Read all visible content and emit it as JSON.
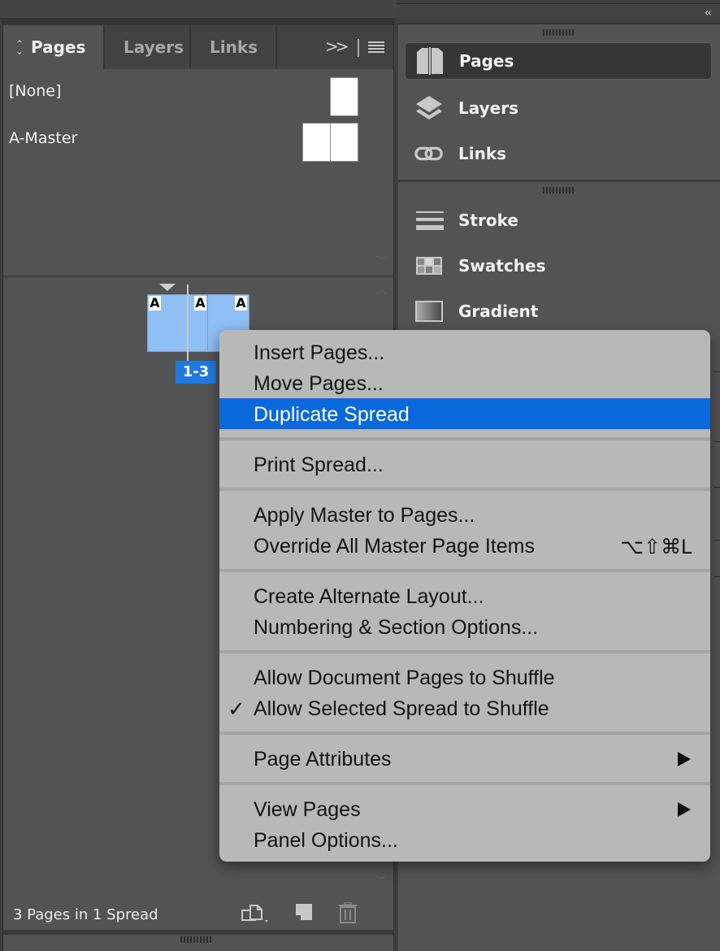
{
  "left_panel": {
    "tabs": [
      {
        "label": "Pages",
        "active": true
      },
      {
        "label": "Layers",
        "active": false
      },
      {
        "label": "Links",
        "active": false
      }
    ],
    "tab_overflow": "»",
    "masters": [
      {
        "name": "[None]",
        "pages": 1
      },
      {
        "name": "A-Master",
        "pages": 2
      }
    ],
    "spread": {
      "page_label": "1-3",
      "page_count": 3,
      "master_prefix": "A"
    },
    "footer": {
      "status": "3 Pages in 1 Spread",
      "icons": [
        "edit-page-size-icon",
        "new-page-icon",
        "delete-page-icon"
      ]
    }
  },
  "right_dock": {
    "collapse_label": "‹‹",
    "groups": [
      {
        "items": [
          {
            "label": "Pages",
            "icon": "pages-icon",
            "active": true
          },
          {
            "label": "Layers",
            "icon": "layers-icon",
            "active": false
          },
          {
            "label": "Links",
            "icon": "links-icon",
            "active": false
          }
        ]
      },
      {
        "items": [
          {
            "label": "Stroke",
            "icon": "stroke-icon",
            "active": false
          },
          {
            "label": "Swatches",
            "icon": "swatches-icon",
            "active": false
          },
          {
            "label": "Gradient",
            "icon": "gradient-icon",
            "active": false
          }
        ]
      }
    ]
  },
  "context_menu": {
    "highlight_color": "#0a68dd",
    "groups": [
      [
        {
          "label": "Insert Pages..."
        },
        {
          "label": "Move Pages..."
        },
        {
          "label": "Duplicate Spread",
          "highlighted": true
        }
      ],
      [
        {
          "label": "Print Spread..."
        }
      ],
      [
        {
          "label": "Apply Master to Pages..."
        },
        {
          "label": "Override All Master Page Items",
          "shortcut": "⌥⇧⌘L"
        }
      ],
      [
        {
          "label": "Create Alternate Layout..."
        },
        {
          "label": "Numbering & Section Options..."
        }
      ],
      [
        {
          "label": "Allow Document Pages to Shuffle"
        },
        {
          "label": "Allow Selected Spread to Shuffle",
          "checked": true,
          "check_mark": "✓"
        }
      ],
      [
        {
          "label": "Page Attributes",
          "submenu": true
        }
      ],
      [
        {
          "label": "View Pages",
          "submenu": true
        },
        {
          "label": "Panel Options..."
        }
      ]
    ]
  }
}
